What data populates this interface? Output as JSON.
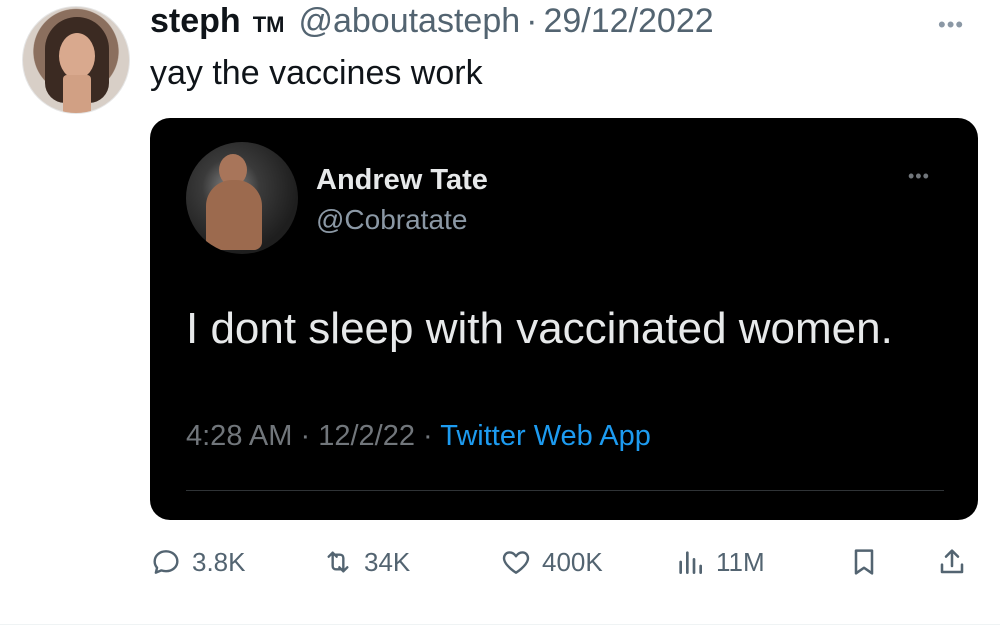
{
  "author": {
    "display_name": "steph",
    "badge": "TM",
    "handle": "@aboutasteph",
    "separator": "·",
    "date": "29/12/2022"
  },
  "tweet_text": "yay the vaccines work",
  "quoted": {
    "display_name": "Andrew Tate",
    "handle": "@Cobratate",
    "text": "I dont sleep with vaccinated women.",
    "time": "4:28 AM",
    "date": "12/2/22",
    "source": "Twitter Web App",
    "separator": "·"
  },
  "actions": {
    "replies": "3.8K",
    "retweets": "34K",
    "likes": "400K",
    "views": "11M"
  },
  "icons": {
    "more": "more-dots-icon",
    "reply": "reply-icon",
    "retweet": "retweet-icon",
    "like": "heart-icon",
    "views": "views-icon",
    "bookmark": "bookmark-icon",
    "share": "share-icon"
  },
  "colors": {
    "secondary_text": "#536471",
    "link": "#1d9bf0",
    "embed_bg": "#000000"
  }
}
